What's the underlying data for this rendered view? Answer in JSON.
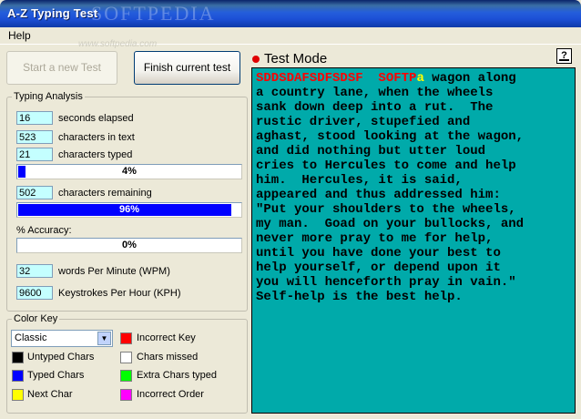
{
  "window": {
    "title": "A-Z Typing Test"
  },
  "watermark": {
    "text": "SOFTPEDIA",
    "url": "www.softpedia.com"
  },
  "menu": {
    "help": "Help"
  },
  "buttons": {
    "start": "Start a new Test",
    "finish": "Finish current test"
  },
  "analysis": {
    "title": "Typing Analysis",
    "seconds_elapsed": {
      "value": "16",
      "label": "seconds elapsed"
    },
    "chars_in_text": {
      "value": "523",
      "label": "characters in text"
    },
    "chars_typed": {
      "value": "21",
      "label": "characters typed"
    },
    "typed_progress": {
      "text": "4%",
      "fraction": 0.04
    },
    "chars_remaining": {
      "value": "502",
      "label": "characters remaining"
    },
    "remaining_progress": {
      "text": "96%",
      "fraction": 0.96
    },
    "accuracy_label": "% Accuracy:",
    "accuracy_progress": {
      "text": "0%",
      "fraction": 0.0
    },
    "wpm": {
      "value": "32",
      "label": "words Per Minute (WPM)"
    },
    "kph": {
      "value": "9600",
      "label": "Keystrokes Per Hour (KPH)"
    }
  },
  "color_key": {
    "title": "Color Key",
    "scheme": "Classic",
    "items": {
      "untyped": {
        "label": "Untyped Chars",
        "color": "#000000"
      },
      "typed": {
        "label": "Typed Chars",
        "color": "#0000ff"
      },
      "next": {
        "label": "Next Char",
        "color": "#ffff00"
      },
      "incorrect_key": {
        "label": "Incorrect Key",
        "color": "#ff0000"
      },
      "missed": {
        "label": "Chars missed",
        "color": "#ffffff"
      },
      "extra": {
        "label": "Extra Chars typed",
        "color": "#00ff00"
      },
      "incorrect_order": {
        "label": "Incorrect Order",
        "color": "#ff00ff"
      }
    }
  },
  "test": {
    "mode_title": "Test Mode",
    "help_icon": "?",
    "panel_color": "#00aaaa",
    "incorrect_text": "SDDSDAFSDFSDSF  SOFTP",
    "next_char": "a",
    "first_line_rest": " wagon along",
    "lines": [
      "a country lane, when the wheels",
      "sank down deep into a rut.  The",
      "rustic driver, stupefied and",
      "aghast, stood looking at the wagon,",
      "and did nothing but utter loud",
      "cries to Hercules to come and help",
      "him.  Hercules, it is said,",
      "appeared and thus addressed him:",
      "\"Put your shoulders to the wheels,",
      "my man.  Goad on your bullocks, and",
      "never more pray to me for help,",
      "until you have done your best to",
      "help yourself, or depend upon it",
      "you will henceforth pray in vain.\"",
      "Self-help is the best help."
    ]
  }
}
